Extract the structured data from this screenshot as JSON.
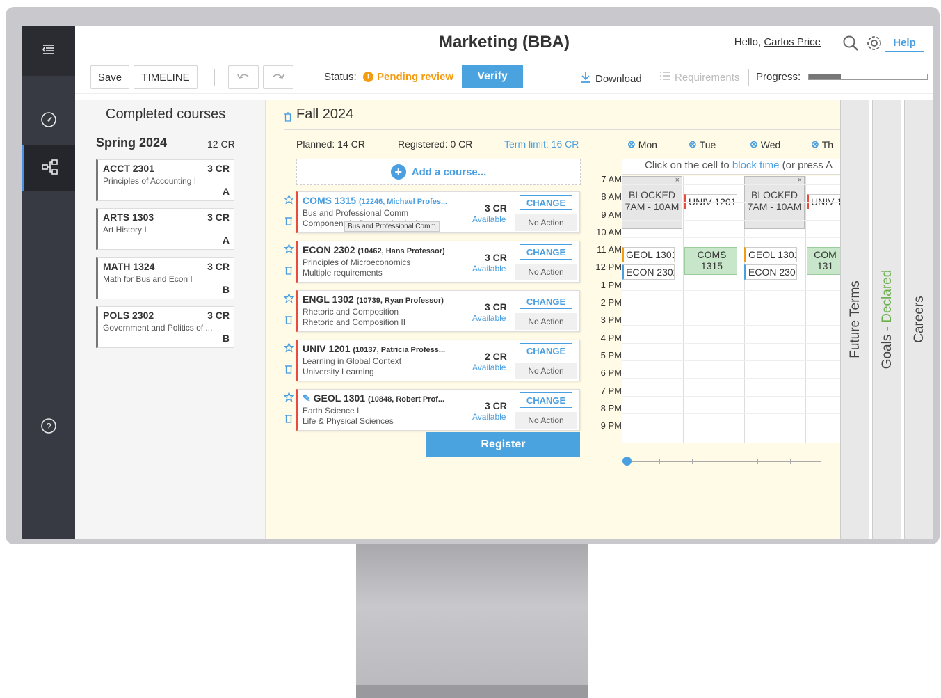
{
  "header": {
    "title": "Marketing (BBA)",
    "hello_prefix": "Hello,",
    "user_name": "Carlos Price",
    "help_label": "Help"
  },
  "toolbar": {
    "save_label": "Save",
    "timeline_label": "TIMELINE",
    "status_label": "Status:",
    "status_value": "Pending review",
    "verify_label": "Verify",
    "download_label": "Download",
    "requirements_label": "Requirements",
    "progress_label": "Progress:",
    "progress_fraction": 0.27
  },
  "completed": {
    "title": "Completed courses",
    "term": "Spring 2024",
    "term_credits": "12 CR",
    "courses": [
      {
        "code": "ACCT 2301",
        "credits": "3 CR",
        "name": "Principles of Accounting I",
        "grade": "A"
      },
      {
        "code": "ARTS 1303",
        "credits": "3 CR",
        "name": "Art History I",
        "grade": "A"
      },
      {
        "code": "MATH 1324",
        "credits": "3 CR",
        "name": "Math for Bus and Econ I",
        "grade": "B"
      },
      {
        "code": "POLS 2302",
        "credits": "3 CR",
        "name": "Government and Politics of ...",
        "grade": "B"
      }
    ]
  },
  "fall": {
    "title": "Fall 2024",
    "planned": "Planned: 14 CR",
    "registered": "Registered: 0 CR",
    "term_limit": "Term limit: 16 CR",
    "add_course": "Add a course...",
    "register_label": "Register",
    "tooltip": "Bus and Professional Comm",
    "courses": [
      {
        "code": "COMS 1315",
        "section": "(12246, Michael Profes...",
        "line2": "Bus and Professional Comm",
        "line3": "Component 1 (Communication)",
        "credits": "3 CR",
        "avail": "Available",
        "change": "CHANGE",
        "action": "No Action"
      },
      {
        "code": "ECON 2302",
        "section": "(10462, Hans Professor)",
        "line2": "Principles of Microeconomics",
        "line3": "Multiple requirements",
        "credits": "3 CR",
        "avail": "Available",
        "change": "CHANGE",
        "action": "No Action"
      },
      {
        "code": "ENGL 1302",
        "section": "(10739, Ryan Professor)",
        "line2": "Rhetoric and Composition",
        "line3": "Rhetoric and Composition II",
        "credits": "3 CR",
        "avail": "Available",
        "change": "CHANGE",
        "action": "No Action"
      },
      {
        "code": "UNIV 1201",
        "section": "(10137, Patricia Profess...",
        "line2": "Learning in Global Context",
        "line3": "University Learning",
        "credits": "2 CR",
        "avail": "Available",
        "change": "CHANGE",
        "action": "No Action"
      },
      {
        "code": "GEOL 1301",
        "section": "(10848, Robert Prof...",
        "line2": "Earth Science I",
        "line3": "Life & Physical Sciences",
        "credits": "3 CR",
        "avail": "Available",
        "change": "CHANGE",
        "action": "No Action"
      }
    ]
  },
  "schedule": {
    "days": [
      "Mon",
      "Tue",
      "Wed",
      "Th"
    ],
    "hint_prefix": "Click on the cell to",
    "hint_link": "block time",
    "hint_suffix": "(or press A",
    "times": [
      "7 AM",
      "8 AM",
      "9 AM",
      "10 AM",
      "11 AM",
      "12 PM",
      "1 PM",
      "2 PM",
      "3 PM",
      "4 PM",
      "5 PM",
      "6 PM",
      "7 PM",
      "8 PM",
      "9 PM"
    ],
    "blocked_label": "BLOCKED",
    "blocked_time": "7AM - 10AM",
    "ev_univ": "UNIV 1201",
    "ev_univ_cut": "UNIV 1",
    "ev_geol": "GEOL 1301",
    "ev_econ": "ECON 2302",
    "ev_coms_a": "COMS",
    "ev_coms_b": "1315",
    "ev_coms_cut_a": "COM",
    "ev_coms_cut_b": "131"
  },
  "right_tabs": {
    "future": "Future Terms",
    "goals_prefix": "Goals - ",
    "goals_status": "Declared",
    "careers": "Careers"
  },
  "colors": {
    "accent": "#4aa3df",
    "pending": "#f39c12",
    "blocked": "#e6e6e6",
    "coms": "#c8e6c9"
  }
}
